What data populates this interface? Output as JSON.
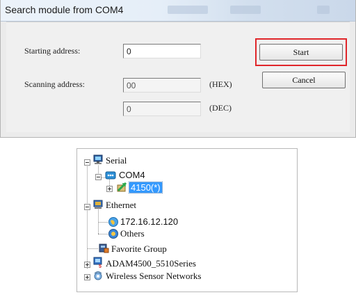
{
  "dialog": {
    "title": "Search module from COM4",
    "starting_label": "Starting address:",
    "starting_value": "0",
    "scanning_label": "Scanning address:",
    "scan_hex_value": "00",
    "hex_unit": "(HEX)",
    "scan_dec_value": "0",
    "dec_unit": "(DEC)",
    "start_label": "Start",
    "cancel_label": "Cancel",
    "highlight_color": "#e0262a"
  },
  "tree": {
    "serial": "Serial",
    "com4": "COM4",
    "module": "4150(*)",
    "ethernet": "Ethernet",
    "ip": "172.16.12.120",
    "others": "Others",
    "favorite": "Favorite Group",
    "adam": "ADAM4500_5510Series",
    "wireless": "Wireless Sensor Networks"
  }
}
